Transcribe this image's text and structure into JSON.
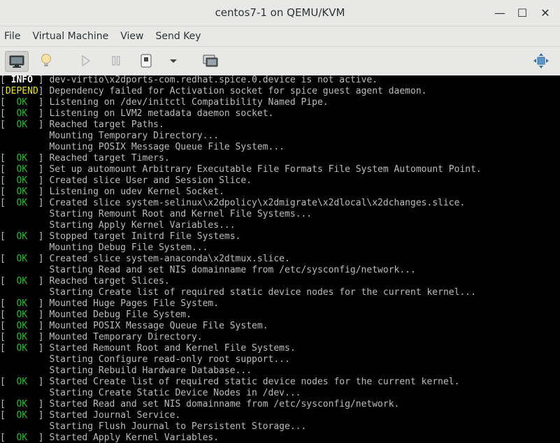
{
  "window": {
    "title": "centos7-1 on QEMU/KVM",
    "minimize": "—",
    "maximize": "☐",
    "close": "✕"
  },
  "menubar": {
    "items": [
      "File",
      "Virtual Machine",
      "View",
      "Send Key"
    ]
  },
  "toolbar": {
    "buttons": [
      {
        "name": "console-view-button",
        "icon": "monitor-icon",
        "pressed": true
      },
      {
        "name": "details-view-button",
        "icon": "lightbulb-icon",
        "pressed": false
      },
      {
        "name": "run-button",
        "icon": "play-icon",
        "pressed": false
      },
      {
        "name": "pause-button",
        "icon": "pause-icon",
        "pressed": false
      },
      {
        "name": "shutdown-button",
        "icon": "power-icon",
        "pressed": false
      },
      {
        "name": "shutdown-menu-button",
        "icon": "chevron-down-icon",
        "pressed": false
      },
      {
        "name": "snapshots-button",
        "icon": "snapshot-icon",
        "pressed": false
      },
      {
        "name": "fullscreen-button",
        "icon": "fullscreen-icon",
        "pressed": false
      }
    ]
  },
  "colors": {
    "ok": "#21c021",
    "info": "#ffffff",
    "depend": "#e5e52a",
    "text": "#bdbdbd",
    "background": "#000000"
  },
  "console": {
    "lines": [
      {
        "bracket_left": "[ ",
        "status": "INFO",
        "status_type": "info",
        "bracket_right": " ] ",
        "text": "dev-virtio\\x2dports-com.redhat.spice.0.device is not active."
      },
      {
        "bracket_left": "[",
        "status": "DEPEND",
        "status_type": "depend",
        "bracket_right": "] ",
        "text": "Dependency failed for Activation socket for spice guest agent daemon."
      },
      {
        "bracket_left": "[  ",
        "status": "OK",
        "status_type": "ok",
        "bracket_right": "  ] ",
        "text": "Listening on /dev/initctl Compatibility Named Pipe."
      },
      {
        "bracket_left": "[  ",
        "status": "OK",
        "status_type": "ok",
        "bracket_right": "  ] ",
        "text": "Listening on LVM2 metadata daemon socket."
      },
      {
        "bracket_left": "[  ",
        "status": "OK",
        "status_type": "ok",
        "bracket_right": "  ] ",
        "text": "Reached target Paths."
      },
      {
        "bracket_left": "",
        "status": "",
        "status_type": "none",
        "bracket_right": "",
        "text": "         Mounting Temporary Directory..."
      },
      {
        "bracket_left": "",
        "status": "",
        "status_type": "none",
        "bracket_right": "",
        "text": "         Mounting POSIX Message Queue File System..."
      },
      {
        "bracket_left": "[  ",
        "status": "OK",
        "status_type": "ok",
        "bracket_right": "  ] ",
        "text": "Reached target Timers."
      },
      {
        "bracket_left": "[  ",
        "status": "OK",
        "status_type": "ok",
        "bracket_right": "  ] ",
        "text": "Set up automount Arbitrary Executable File Formats File System Automount Point."
      },
      {
        "bracket_left": "[  ",
        "status": "OK",
        "status_type": "ok",
        "bracket_right": "  ] ",
        "text": "Created slice User and Session Slice."
      },
      {
        "bracket_left": "[  ",
        "status": "OK",
        "status_type": "ok",
        "bracket_right": "  ] ",
        "text": "Listening on udev Kernel Socket."
      },
      {
        "bracket_left": "[  ",
        "status": "OK",
        "status_type": "ok",
        "bracket_right": "  ] ",
        "text": "Created slice system-selinux\\x2dpolicy\\x2dmigrate\\x2dlocal\\x2dchanges.slice."
      },
      {
        "bracket_left": "",
        "status": "",
        "status_type": "none",
        "bracket_right": "",
        "text": "         Starting Remount Root and Kernel File Systems..."
      },
      {
        "bracket_left": "",
        "status": "",
        "status_type": "none",
        "bracket_right": "",
        "text": "         Starting Apply Kernel Variables..."
      },
      {
        "bracket_left": "[  ",
        "status": "OK",
        "status_type": "ok",
        "bracket_right": "  ] ",
        "text": "Stopped target Initrd File Systems."
      },
      {
        "bracket_left": "",
        "status": "",
        "status_type": "none",
        "bracket_right": "",
        "text": "         Mounting Debug File System..."
      },
      {
        "bracket_left": "[  ",
        "status": "OK",
        "status_type": "ok",
        "bracket_right": "  ] ",
        "text": "Created slice system-anaconda\\x2dtmux.slice."
      },
      {
        "bracket_left": "",
        "status": "",
        "status_type": "none",
        "bracket_right": "",
        "text": "         Starting Read and set NIS domainname from /etc/sysconfig/network..."
      },
      {
        "bracket_left": "[  ",
        "status": "OK",
        "status_type": "ok",
        "bracket_right": "  ] ",
        "text": "Reached target Slices."
      },
      {
        "bracket_left": "",
        "status": "",
        "status_type": "none",
        "bracket_right": "",
        "text": "         Starting Create list of required static device nodes for the current kernel..."
      },
      {
        "bracket_left": "[  ",
        "status": "OK",
        "status_type": "ok",
        "bracket_right": "  ] ",
        "text": "Mounted Huge Pages File System."
      },
      {
        "bracket_left": "[  ",
        "status": "OK",
        "status_type": "ok",
        "bracket_right": "  ] ",
        "text": "Mounted Debug File System."
      },
      {
        "bracket_left": "[  ",
        "status": "OK",
        "status_type": "ok",
        "bracket_right": "  ] ",
        "text": "Mounted POSIX Message Queue File System."
      },
      {
        "bracket_left": "[  ",
        "status": "OK",
        "status_type": "ok",
        "bracket_right": "  ] ",
        "text": "Mounted Temporary Directory."
      },
      {
        "bracket_left": "[  ",
        "status": "OK",
        "status_type": "ok",
        "bracket_right": "  ] ",
        "text": "Started Remount Root and Kernel File Systems."
      },
      {
        "bracket_left": "",
        "status": "",
        "status_type": "none",
        "bracket_right": "",
        "text": "         Starting Configure read-only root support..."
      },
      {
        "bracket_left": "",
        "status": "",
        "status_type": "none",
        "bracket_right": "",
        "text": "         Starting Rebuild Hardware Database..."
      },
      {
        "bracket_left": "[  ",
        "status": "OK",
        "status_type": "ok",
        "bracket_right": "  ] ",
        "text": "Started Create list of required static device nodes for the current kernel."
      },
      {
        "bracket_left": "",
        "status": "",
        "status_type": "none",
        "bracket_right": "",
        "text": "         Starting Create Static Device Nodes in /dev..."
      },
      {
        "bracket_left": "[  ",
        "status": "OK",
        "status_type": "ok",
        "bracket_right": "  ] ",
        "text": "Started Read and set NIS domainname from /etc/sysconfig/network."
      },
      {
        "bracket_left": "[  ",
        "status": "OK",
        "status_type": "ok",
        "bracket_right": "  ] ",
        "text": "Started Journal Service."
      },
      {
        "bracket_left": "",
        "status": "",
        "status_type": "none",
        "bracket_right": "",
        "text": "         Starting Flush Journal to Persistent Storage..."
      },
      {
        "bracket_left": "[  ",
        "status": "OK",
        "status_type": "ok",
        "bracket_right": "  ] ",
        "text": "Started Apply Kernel Variables."
      }
    ]
  }
}
